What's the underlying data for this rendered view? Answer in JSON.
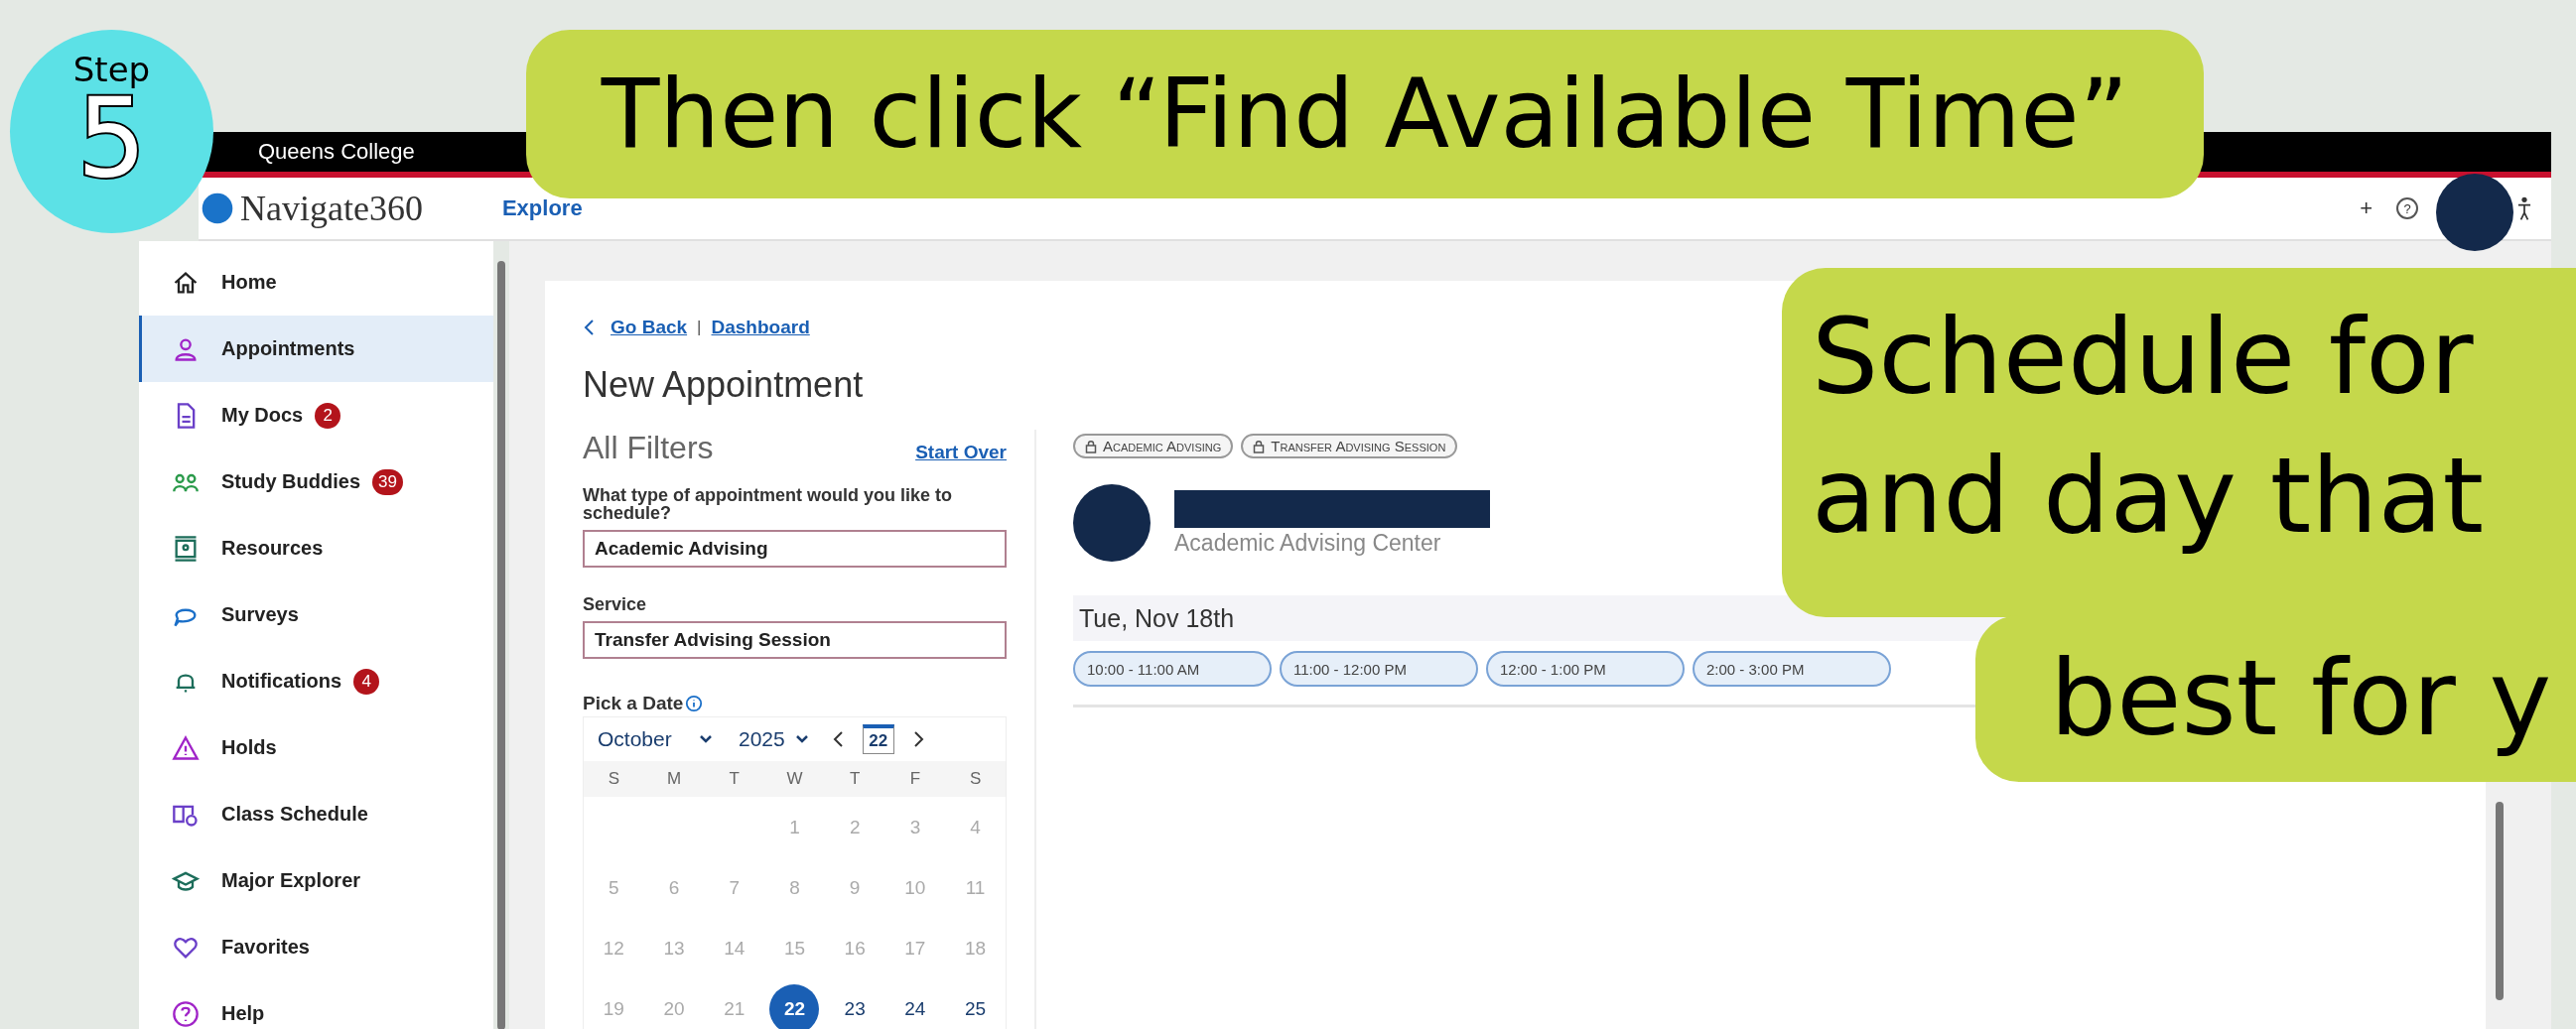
{
  "step": {
    "label": "Step",
    "number": "5"
  },
  "callout_top": "Then click “Find Available Time”",
  "callout_side": {
    "upper": [
      "Schedule for",
      "and day that"
    ],
    "lower": "best for y"
  },
  "topbar": {
    "college": "Queens College"
  },
  "header": {
    "brand": "Navigate360",
    "nav": "Explore",
    "actions": [
      "+",
      "?"
    ]
  },
  "sidebar": {
    "items": [
      {
        "label": "Home",
        "selected": false
      },
      {
        "label": "Appointments",
        "selected": true
      },
      {
        "label": "My Docs",
        "selected": false,
        "badge": "2"
      },
      {
        "label": "Study Buddies",
        "selected": false,
        "badge": "39"
      },
      {
        "label": "Resources",
        "selected": false
      },
      {
        "label": "Surveys",
        "selected": false
      },
      {
        "label": "Notifications",
        "selected": false,
        "badge": "4"
      },
      {
        "label": "Holds",
        "selected": false
      },
      {
        "label": "Class Schedule",
        "selected": false
      },
      {
        "label": "Major Explorer",
        "selected": false
      },
      {
        "label": "Favorites",
        "selected": false
      },
      {
        "label": "Help",
        "selected": false
      }
    ]
  },
  "breadcrumb": {
    "back": "Go Back",
    "separator": "|",
    "link": "Dashboard"
  },
  "title": "New Appointment",
  "filters": {
    "title": "All Filters",
    "reset": "Start Over",
    "fields": [
      {
        "label": "What type of appointment would you like to schedule?",
        "value": "Academic Advising"
      },
      {
        "label": "Service",
        "value": "Transfer Advising Session"
      }
    ],
    "date_label": "Pick a Date",
    "calendar": {
      "month": "October",
      "year": "2025",
      "today": "22",
      "weekdays": [
        "S",
        "M",
        "T",
        "W",
        "T",
        "F",
        "S"
      ],
      "weeks": [
        {
          "leading_gap": true,
          "days": [
            {
              "day": "1",
              "disabled": true,
              "selected": false
            },
            {
              "day": "2",
              "disabled": true,
              "selected": false
            },
            {
              "day": "3",
              "disabled": true,
              "selected": false
            },
            {
              "day": "4",
              "disabled": true,
              "selected": false
            }
          ]
        },
        {
          "days": [
            {
              "day": "5",
              "disabled": true,
              "selected": false
            },
            {
              "day": "6",
              "disabled": true,
              "selected": false
            },
            {
              "day": "7",
              "disabled": true,
              "selected": false
            },
            {
              "day": "8",
              "disabled": true,
              "selected": false
            },
            {
              "day": "9",
              "disabled": true,
              "selected": false
            },
            {
              "day": "10",
              "disabled": true,
              "selected": false
            },
            {
              "day": "11",
              "disabled": true,
              "selected": false
            }
          ]
        },
        {
          "days": [
            {
              "day": "12",
              "disabled": true,
              "selected": false
            },
            {
              "day": "13",
              "disabled": true,
              "selected": false
            },
            {
              "day": "14",
              "disabled": true,
              "selected": false
            },
            {
              "day": "15",
              "disabled": true,
              "selected": false
            },
            {
              "day": "16",
              "disabled": true,
              "selected": false
            },
            {
              "day": "17",
              "disabled": true,
              "selected": false
            },
            {
              "day": "18",
              "disabled": true,
              "selected": false
            }
          ]
        },
        {
          "days": [
            {
              "day": "19",
              "disabled": true,
              "selected": false
            },
            {
              "day": "20",
              "disabled": true,
              "selected": false
            },
            {
              "day": "21",
              "disabled": true,
              "selected": false
            },
            {
              "day": "22",
              "disabled": false,
              "selected": true
            },
            {
              "day": "23",
              "disabled": false,
              "selected": false
            },
            {
              "day": "24",
              "disabled": false,
              "selected": false
            },
            {
              "day": "25",
              "disabled": false,
              "selected": false
            }
          ]
        }
      ]
    }
  },
  "results": {
    "tags": [
      "Academic Advising",
      "Transfer Advising Session"
    ],
    "advisor_org": "Academic Advising Center",
    "date": "Tue, Nov 18th",
    "slots": [
      "10:00 - 11:00 AM",
      "11:00 - 12:00 PM",
      "12:00 - 1:00 PM",
      "2:00 - 3:00 PM"
    ]
  }
}
